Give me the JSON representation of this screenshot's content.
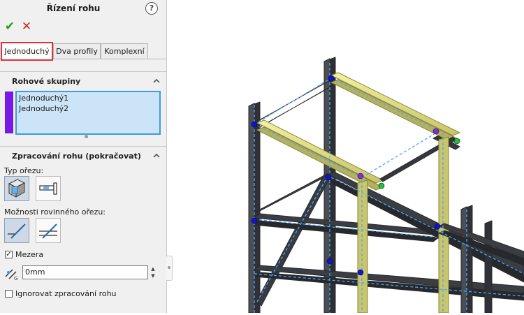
{
  "panel": {
    "title": "Řízení rohu",
    "help_symbol": "?",
    "ok_symbol": "✔",
    "cancel_symbol": "✕",
    "colors": {
      "ok": "#1b9e1b",
      "cancel": "#d42020",
      "group_color": "#7a19e6",
      "active_tab_border": "#e0303c"
    }
  },
  "tabs": [
    {
      "label": "Jednoduchý",
      "active": true
    },
    {
      "label": "Dva profily",
      "active": false
    },
    {
      "label": "Komplexní",
      "active": false
    }
  ],
  "corner_groups": {
    "title": "Rohové skupiny",
    "items": [
      "Jednoduchý1",
      "Jednoduchý2"
    ]
  },
  "corner_treatment": {
    "title": "Zpracování rohu (pokračovat)",
    "trim_type_label": "Typ ořezu:",
    "planar_trim_label": "Možnosti rovinného ořezu:",
    "gap_label": "Mezera",
    "gap_checked": true,
    "gap_value": "0mm",
    "ignore_label": "Ignorovat zpracování rohu",
    "ignore_checked": false
  },
  "icons": {
    "trim_type_1": "corner-trim-miter-icon",
    "trim_type_2": "corner-trim-butt-icon",
    "planar_1": "planar-trim-icon",
    "planar_2": "planar-trim-alt-icon",
    "gap": "gap-dimension-icon"
  }
}
